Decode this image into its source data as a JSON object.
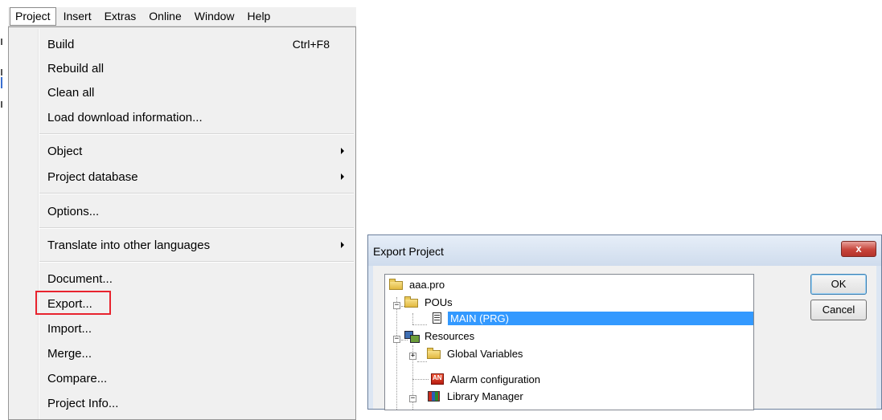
{
  "menubar": {
    "items": [
      "Project",
      "Insert",
      "Extras",
      "Online",
      "Window",
      "Help"
    ],
    "active": "Project"
  },
  "project_menu": {
    "items": [
      {
        "label": "Build",
        "shortcut": "Ctrl+F8"
      },
      {
        "label": "Rebuild all"
      },
      {
        "label": "Clean all"
      },
      {
        "label": "Load download information..."
      },
      {
        "label": "Object",
        "submenu": true
      },
      {
        "label": "Project database",
        "submenu": true
      },
      {
        "label": "Options..."
      },
      {
        "label": "Translate into other languages",
        "submenu": true
      },
      {
        "label": "Document..."
      },
      {
        "label": "Export..."
      },
      {
        "label": "Import..."
      },
      {
        "label": "Merge..."
      },
      {
        "label": "Compare..."
      },
      {
        "label": "Project Info..."
      }
    ],
    "highlighted_item": "Export...",
    "highlight_color": "#e8232e"
  },
  "export_dialog": {
    "title": "Export Project",
    "close_label": "x",
    "tree": {
      "root": "aaa.pro",
      "pous_folder": "POUs",
      "pou_main": "MAIN (PRG)",
      "resources": "Resources",
      "global_variables": "Global Variables",
      "alarm_configuration": "Alarm configuration",
      "library_manager": "Library Manager"
    },
    "selected_node": "MAIN (PRG)",
    "selection_color": "#3399ff",
    "ok_label": "OK",
    "cancel_label": "Cancel"
  }
}
